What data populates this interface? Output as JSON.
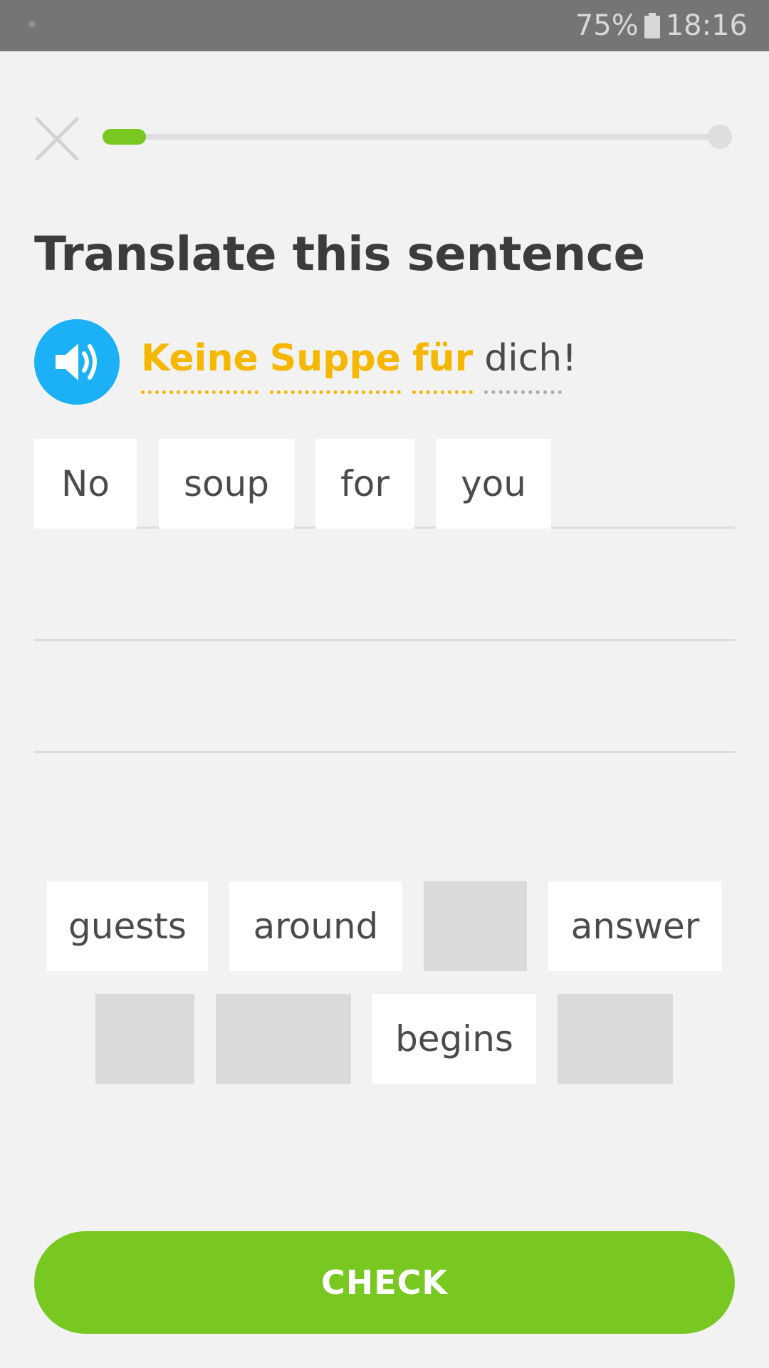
{
  "status_bar": {
    "battery": "75%",
    "time": "18:16",
    "battery_icon": "battery-icon"
  },
  "progress": {
    "fraction": 0.07,
    "accent": "#78c821"
  },
  "prompt": {
    "title": "Translate this sentence"
  },
  "sentence": {
    "speaker_icon": "speaker-icon",
    "speaker_color": "#1cb0f6",
    "words": [
      {
        "text": "Keine",
        "highlighted": true
      },
      {
        "text": "Suppe",
        "highlighted": true
      },
      {
        "text": "für",
        "highlighted": true
      },
      {
        "text": "dich",
        "highlighted": false
      }
    ],
    "punctuation": "!"
  },
  "answer": {
    "tiles": [
      "No",
      "soup",
      "for",
      "you"
    ]
  },
  "word_bank": {
    "row1": [
      "guests",
      "around",
      "",
      "answer"
    ],
    "row2": [
      "",
      "",
      "begins",
      ""
    ]
  },
  "check_button": {
    "label": "CHECK",
    "color": "#78c821"
  }
}
